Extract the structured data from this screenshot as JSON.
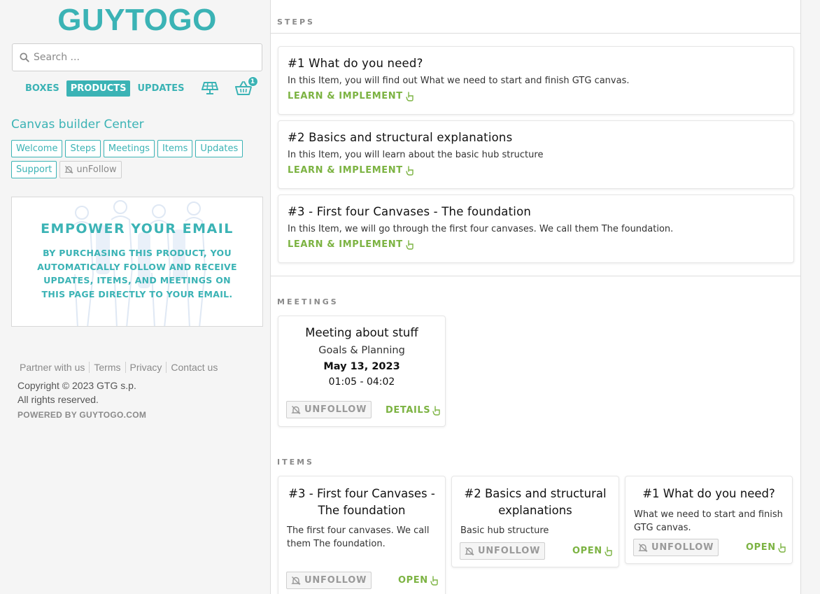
{
  "brand": {
    "logo": "GUYTOGO"
  },
  "search": {
    "placeholder": "Search ..."
  },
  "topnav": {
    "items": [
      {
        "label": "BOXES",
        "active": false
      },
      {
        "label": "PRODUCTS",
        "active": true
      },
      {
        "label": "UPDATES",
        "active": false
      }
    ],
    "grid_icon": "solar-panel-icon",
    "basket_icon": "basket-icon",
    "basket_count": "1"
  },
  "sidebar": {
    "center_title": "Canvas builder Center",
    "tags": [
      "Welcome",
      "Steps",
      "Meetings",
      "Items",
      "Updates",
      "Support"
    ],
    "unfollow_label": "unFollow",
    "promo": {
      "title": "EMPOWER YOUR EMAIL",
      "text": "BY PURCHASING THIS PRODUCT, YOU AUTOMATICALLY FOLLOW AND RECEIVE UPDATES, ITEMS, AND MEETINGS ON THIS PAGE DIRECTLY TO YOUR EMAIL."
    },
    "footer": {
      "links": [
        "Partner with us",
        "Terms",
        "Privacy",
        "Contact us"
      ],
      "copyright_line1": "Copyright © 2023 GTG s.p.",
      "copyright_line2": "All rights reserved.",
      "powered": "POWERED BY GUYTOGO.COM"
    }
  },
  "main": {
    "steps": {
      "label": "STEPS",
      "cards": [
        {
          "title": "#1 What do you need?",
          "text": "In this Item, you will find out What we need to start and finish GTG canvas.",
          "action": "LEARN & IMPLEMENT"
        },
        {
          "title": "#2 Basics and structural explanations",
          "text": "In this Item, you will learn about the basic hub structure",
          "action": "LEARN & IMPLEMENT"
        },
        {
          "title": "#3 - First four Canvases - The foundation",
          "text": "In this Item, we will go through the first four canvases. We call them The foundation.",
          "action": "LEARN & IMPLEMENT"
        }
      ]
    },
    "meetings": {
      "label": "MEETINGS",
      "card": {
        "title": "Meeting about stuff",
        "subtitle": "Goals & Planning",
        "date": "May 13, 2023",
        "time": "01:05 - 04:02",
        "unfollow": "UNFOLLOW",
        "details": "DETAILS"
      }
    },
    "items": {
      "label": "ITEMS",
      "cards": [
        {
          "title": "#3 - First four Canvases - The foundation",
          "text": "The first four canvases. We call them The foundation.",
          "unfollow": "UNFOLLOW",
          "open": "OPEN"
        },
        {
          "title": "#2 Basics and structural explanations",
          "text": "Basic hub structure",
          "unfollow": "UNFOLLOW",
          "open": "OPEN"
        },
        {
          "title": "#1 What do you need?",
          "text": "What we need to start and finish GTG canvas.",
          "unfollow": "UNFOLLOW",
          "open": "OPEN"
        }
      ]
    }
  },
  "colors": {
    "accent": "#3bb3b5",
    "action_green": "#7cb342",
    "muted": "#8a8a8a"
  }
}
